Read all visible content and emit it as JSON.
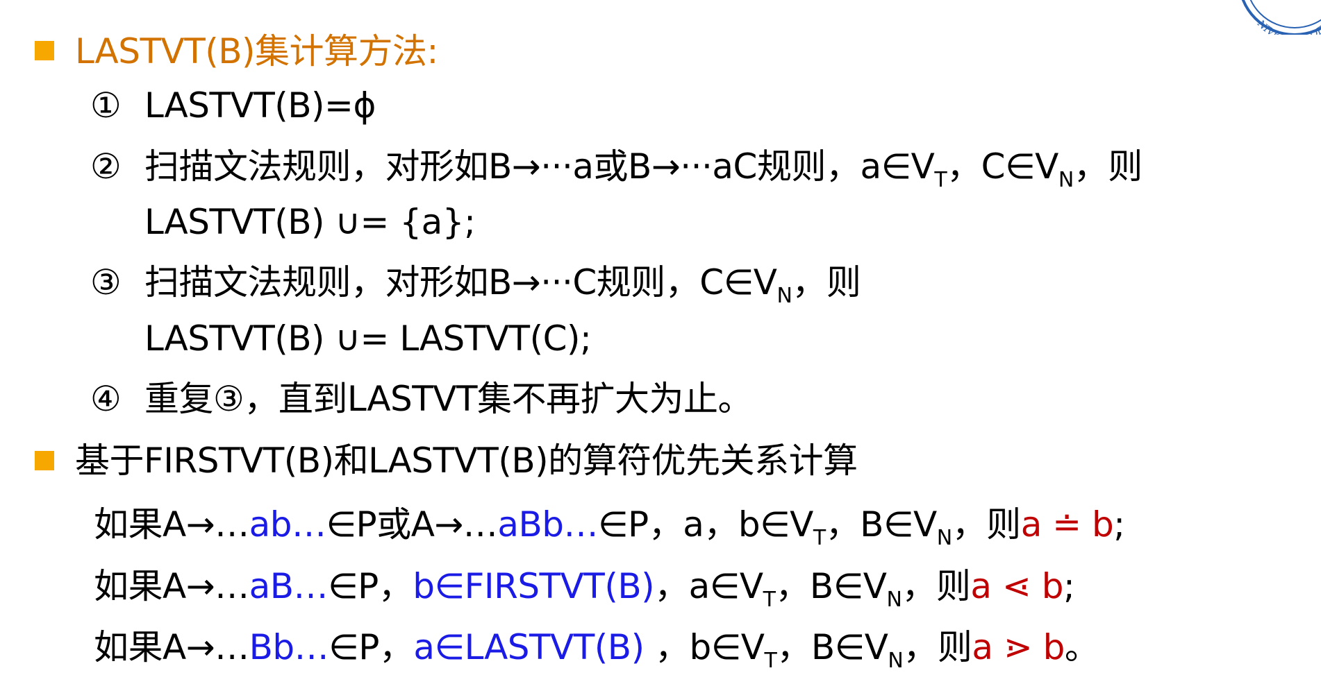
{
  "seal": {
    "text": "NIVERSITY OF"
  },
  "section1": {
    "heading": "LASTVT(B)集计算方法:",
    "step1": {
      "num": "①",
      "text": "LASTVT(B)=ϕ"
    },
    "step2": {
      "num": "②",
      "line1": {
        "a": "扫描文法规则，对形如B→···a或B→···aC规则，a∈V",
        "sub1": "T",
        "b": "，C∈V",
        "sub2": "N",
        "c": "，则"
      },
      "line2": "LASTVT(B)  ∪= {a};"
    },
    "step3": {
      "num": "③",
      "line1": {
        "a": "扫描文法规则，对形如B→···C规则，C∈V",
        "sub1": "N",
        "b": "，则"
      },
      "line2": "LASTVT(B) ∪=  LASTVT(C);"
    },
    "step4": {
      "num": "④",
      "text": "重复③，直到LASTVT集不再扩大为止。"
    }
  },
  "section2": {
    "heading": "基于FIRSTVT(B)和LASTVT(B)的算符优先关系计算",
    "rule1": {
      "p1": "如果A→…",
      "b1": "ab…",
      "p2": "∈P或A→…",
      "b2": "aBb…",
      "p3": "∈P，a，b∈V",
      "sub1": "T",
      "p4": "，B∈V",
      "sub2": "N",
      "p5": "，则",
      "rel": "a ≐ b",
      "end": ";"
    },
    "rule2": {
      "p1": "如果A→…",
      "b1": "aB…",
      "p2": "∈P，",
      "b2": "b∈FIRSTVT(B)",
      "p3": "，a∈V",
      "sub1": "T",
      "p4": "，B∈V",
      "sub2": "N",
      "p5": "，则",
      "rel": "a ⋖ b",
      "end": ";"
    },
    "rule3": {
      "p1": "如果A→…",
      "b1": "Bb…",
      "p2": "∈P，",
      "b2": "a∈LASTVT(B)",
      "p3": " ，b∈V",
      "sub1": "T",
      "p4": "，B∈V",
      "sub2": "N",
      "p5": "，则",
      "rel": "a ⋗ b",
      "end": "。"
    }
  }
}
